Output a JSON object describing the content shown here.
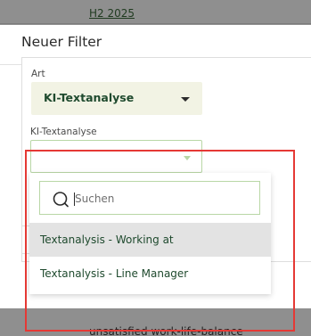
{
  "background": {
    "header_text": "H2 2025",
    "bottom_text": "unsatisfied work-life-balance"
  },
  "modal": {
    "title": "Neuer Filter"
  },
  "form": {
    "art": {
      "label": "Art",
      "value": "KI-Textanalyse"
    },
    "ki_textanalyse": {
      "label": "KI-Textanalyse",
      "value": ""
    }
  },
  "dropdown": {
    "search_placeholder": "Suchen",
    "options": [
      {
        "label": "Textanalysis - Working at",
        "hovered": true
      },
      {
        "label": "Textanalysis - Line Manager",
        "hovered": false
      }
    ]
  },
  "colors": {
    "accent_green": "#1f4a2e",
    "border_green": "#b9d7a6",
    "highlight_red": "#e53935",
    "select_bg": "#f2f3e4"
  },
  "icons": {
    "select_caret": "chevron-down-icon",
    "search": "search-icon"
  }
}
